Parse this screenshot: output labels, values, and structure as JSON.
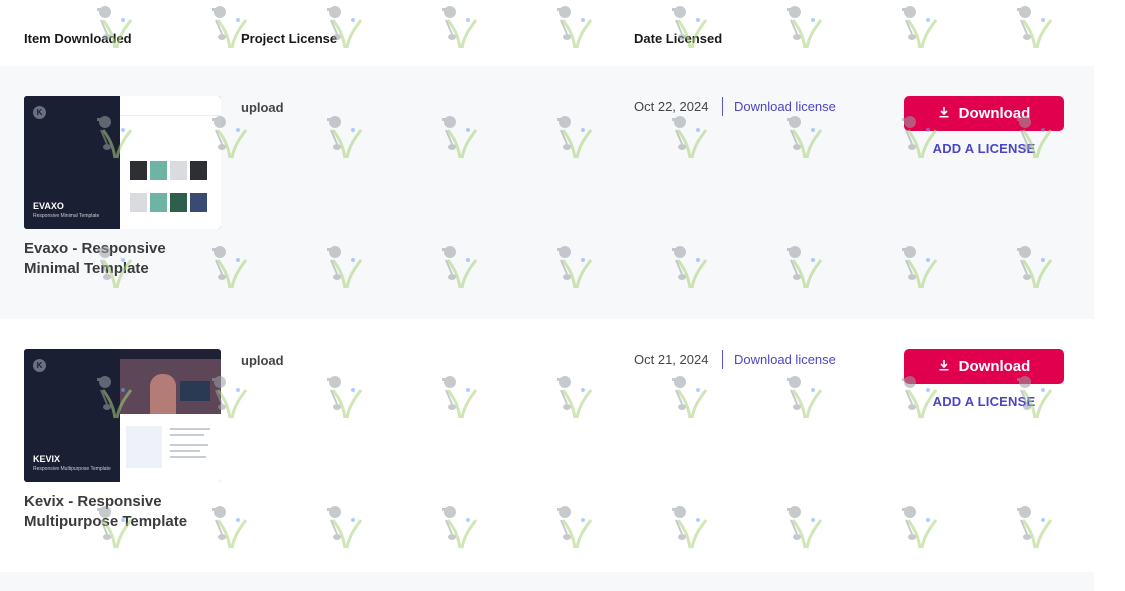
{
  "header": {
    "item_downloaded": "Item Downloaded",
    "project_license": "Project License",
    "date_licensed": "Date Licensed"
  },
  "items": [
    {
      "title": "Evaxo - Responsive Minimal Template",
      "thumbnail_name": "EVAXO",
      "thumbnail_subtitle": "Responsive Minimal Template",
      "project_license": "upload",
      "date_licensed": "Oct 22, 2024",
      "download_license_label": "Download license",
      "download_button_label": "Download",
      "add_license_label": "ADD A LICENSE"
    },
    {
      "title": "Kevix - Responsive Multipurpose Template",
      "thumbnail_name": "KEVIX",
      "thumbnail_subtitle": "Responsive Multipurpose Template",
      "project_license": "upload",
      "date_licensed": "Oct 21, 2024",
      "download_license_label": "Download license",
      "download_button_label": "Download",
      "add_license_label": "ADD A LICENSE"
    }
  ],
  "icons": {
    "download_button_icon": "download-arrow-icon",
    "thumbnail_logo": "k-logo-icon"
  },
  "colors": {
    "accent_button": "#e0004d",
    "link": "#4b45c6",
    "row_background": "#f7f8fa"
  }
}
